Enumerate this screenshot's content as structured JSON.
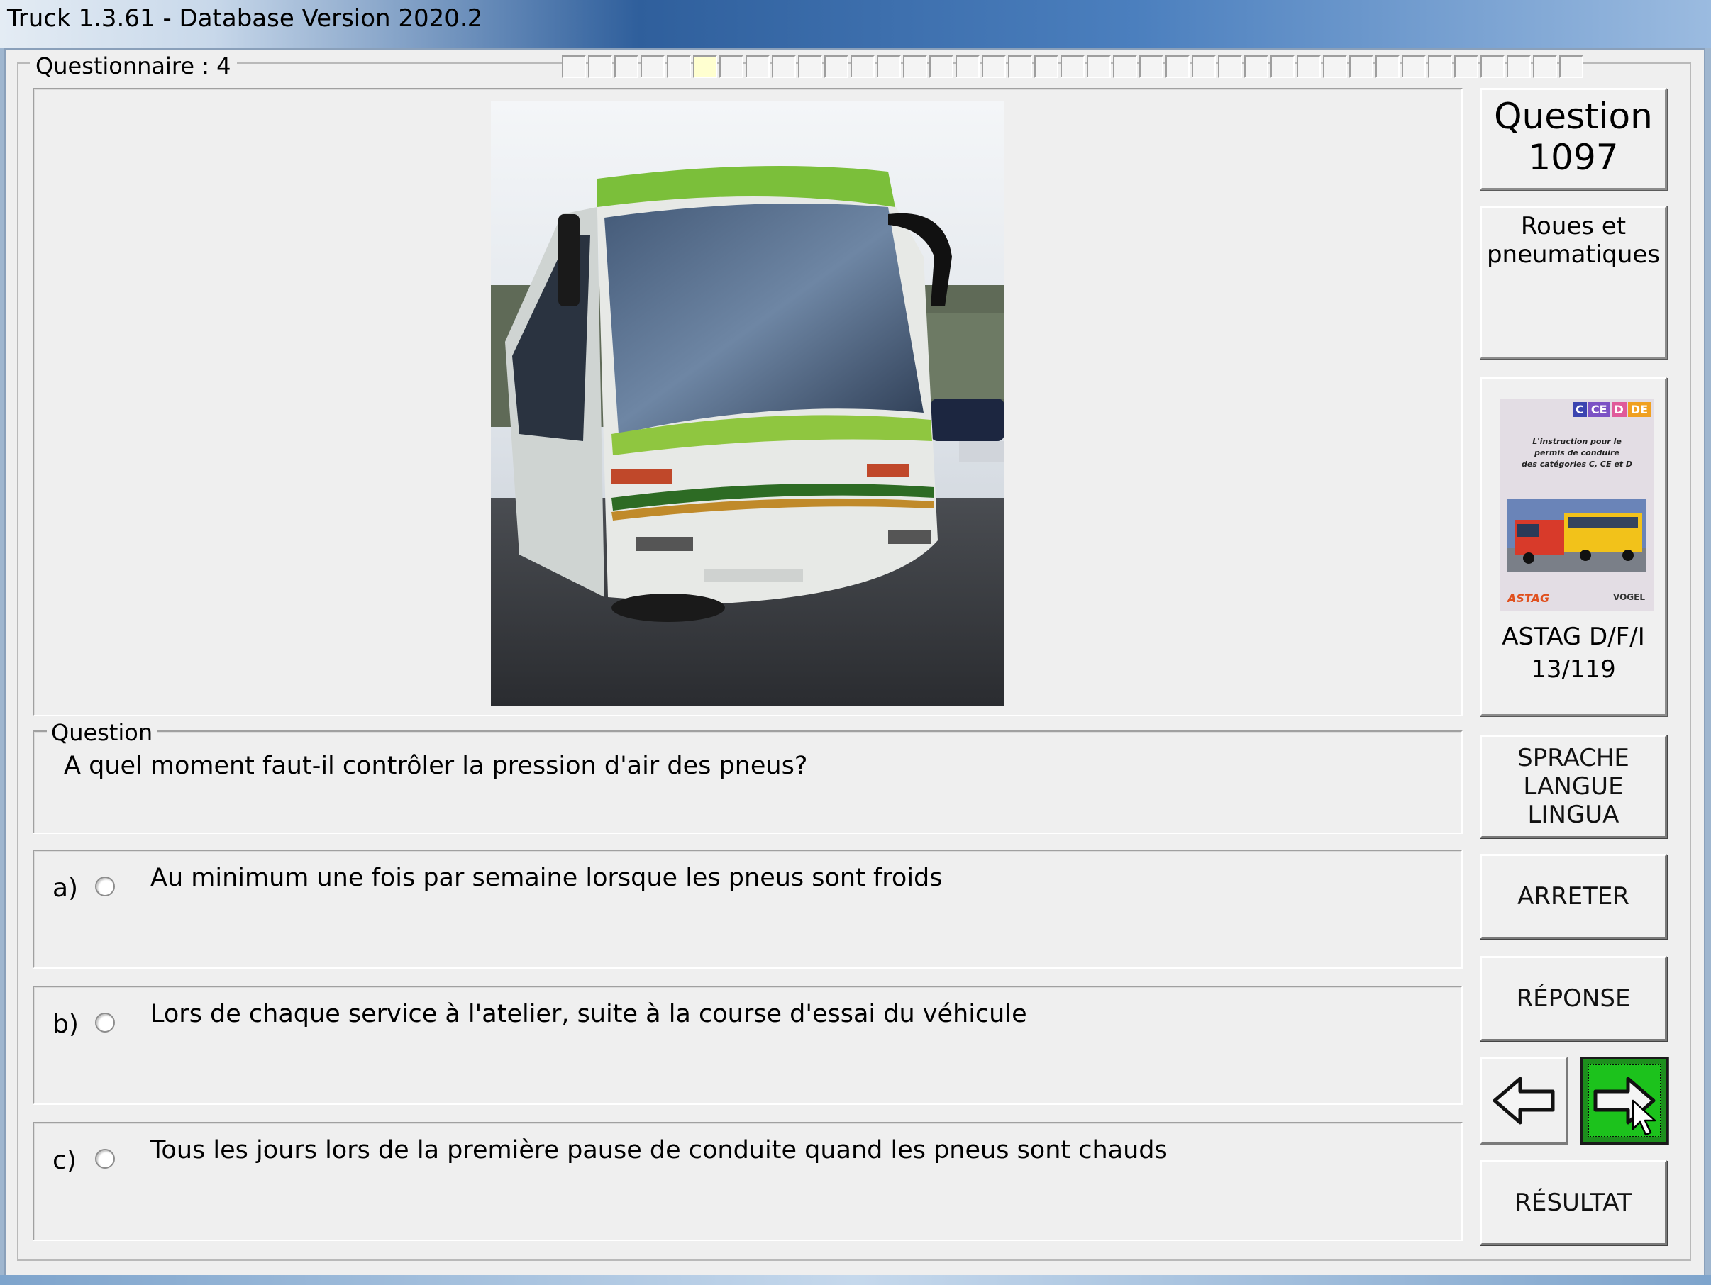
{
  "window": {
    "title": "Truck 1.3.61 - Database Version 2020.2"
  },
  "questionnaire": {
    "label": "Questionnaire : 4",
    "progress_cells": 39,
    "current_index": 5
  },
  "question": {
    "group_label": "Question",
    "text": "A quel moment faut-il contrôler la pression d'air des pneus?",
    "number_label": "Question",
    "number": "1097",
    "category": [
      "Roues et",
      "pneumatiques"
    ]
  },
  "answers": [
    {
      "letter": "a)",
      "text": "Au minimum une fois par semaine lorsque les pneus sont froids",
      "selected": false
    },
    {
      "letter": "b)",
      "text": "Lors de chaque service à l'atelier, suite à la course d'essai du véhicule",
      "selected": false
    },
    {
      "letter": "c)",
      "text": "Tous les jours lors de la première pause de conduite quand les pneus sont chauds",
      "selected": false
    }
  ],
  "book": {
    "badges": [
      "C",
      "CE",
      "D",
      "DE"
    ],
    "cover_text": [
      "L'instruction pour le",
      "permis de conduire",
      "des catégories C, CE et D"
    ],
    "publisher_left": "ASTAG",
    "publisher_right": "VOGEL",
    "reference": "ASTAG D/F/I",
    "page": "13/119"
  },
  "buttons": {
    "language": [
      "SPRACHE",
      "LANGUE",
      "LINGUA"
    ],
    "stop": "ARRETER",
    "answer": "RÉPONSE",
    "result": "RÉSULTAT"
  },
  "icons": {
    "prev": "arrow-left-icon",
    "next": "arrow-right-icon"
  },
  "colors": {
    "next_button": "#1cc21c",
    "title_bar": "#2f5f9c"
  }
}
